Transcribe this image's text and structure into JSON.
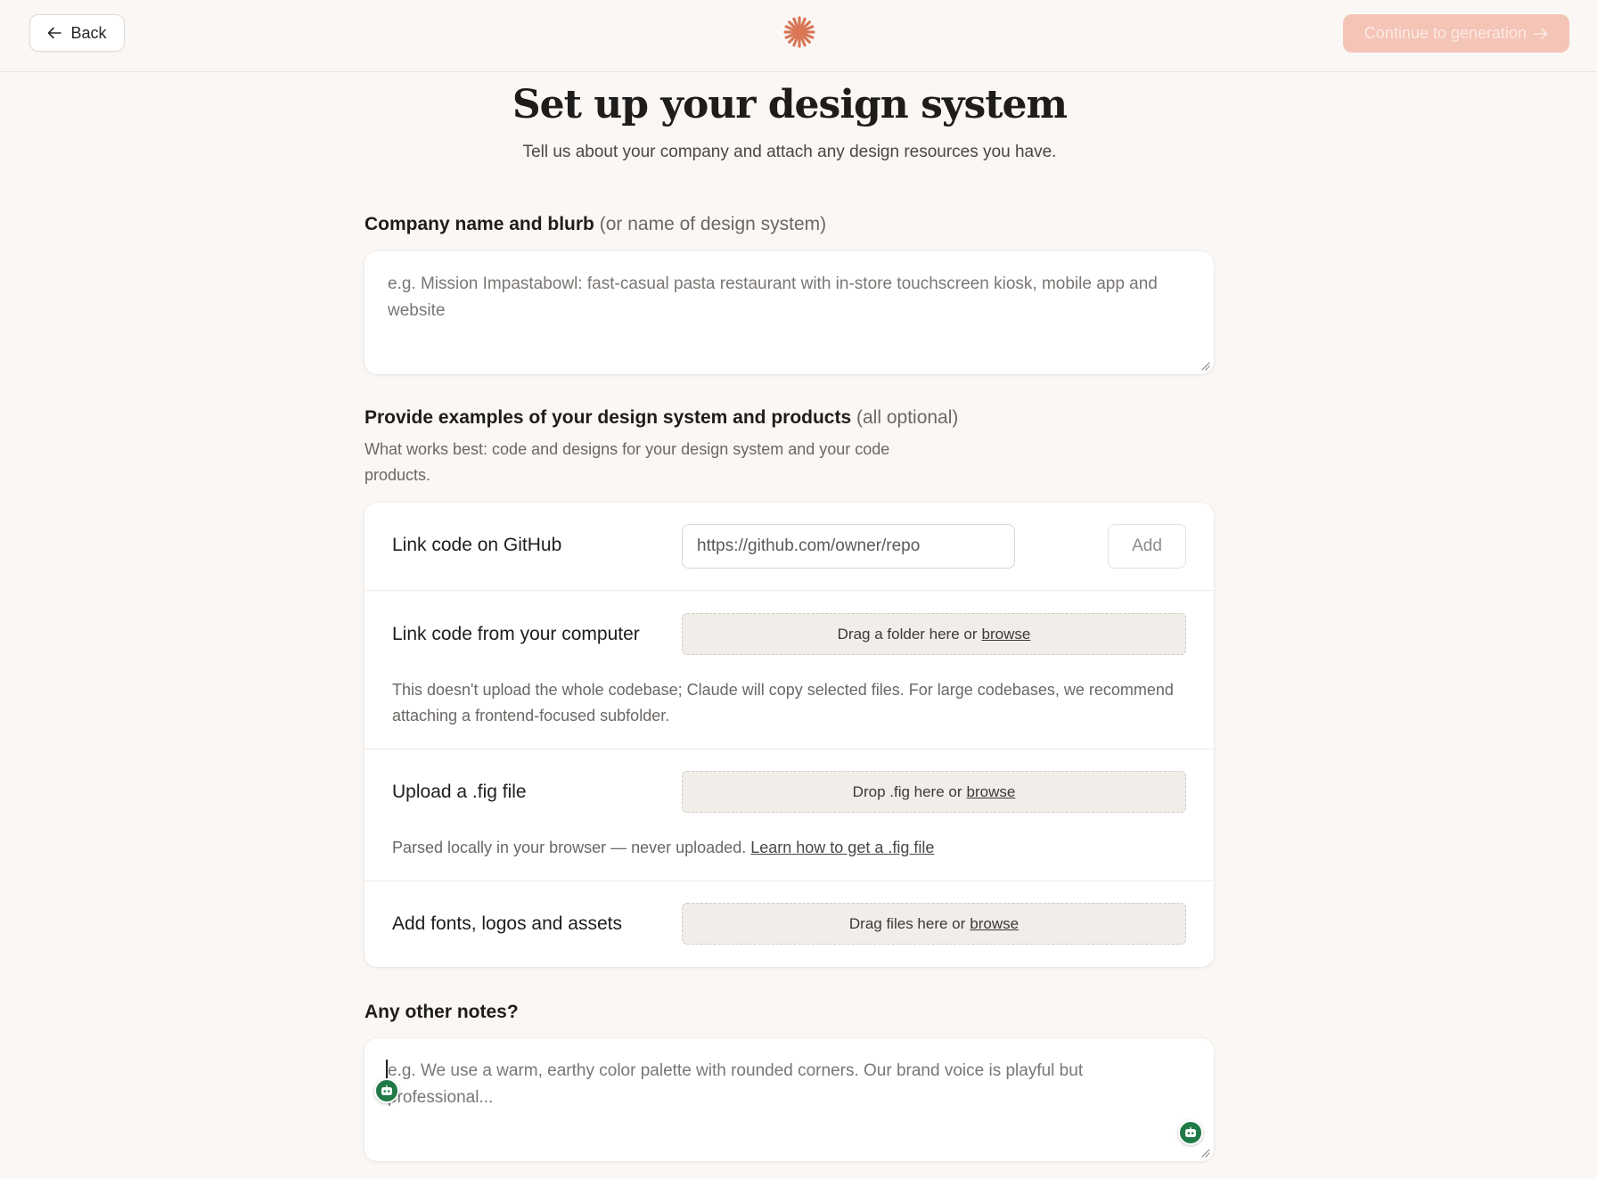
{
  "header": {
    "back_label": "Back",
    "continue_label": "Continue to generation",
    "colors": {
      "accent": "#d97757",
      "continue_bg": "#f4c4b6"
    }
  },
  "page": {
    "title": "Set up your design system",
    "subtitle": "Tell us about your company and attach any design resources you have."
  },
  "company": {
    "label_bold": "Company name and blurb",
    "label_muted": "(or name of design system)",
    "placeholder": "e.g. Mission Impastabowl: fast-casual pasta restaurant with in-store touchscreen kiosk, mobile app and website"
  },
  "examples": {
    "label_bold": "Provide examples of your design system and products",
    "label_muted": "(all optional)",
    "help": "What works best: code and designs for your design system and your code products."
  },
  "github": {
    "label": "Link code on GitHub",
    "placeholder": "https://github.com/owner/repo",
    "add_label": "Add"
  },
  "computer": {
    "label": "Link code from your computer",
    "drop_text": "Drag a folder here or",
    "browse_label": "browse",
    "note": "This doesn't upload the whole codebase; Claude will copy selected files. For large codebases, we recommend attaching a frontend-focused subfolder."
  },
  "fig": {
    "label": "Upload a .fig file",
    "drop_text": "Drop .fig here or",
    "browse_label": "browse",
    "note": "Parsed locally in your browser — never uploaded.",
    "note_link": "Learn how to get a .fig file"
  },
  "assets": {
    "label": "Add fonts, logos and assets",
    "drop_text": "Drag files here or",
    "browse_label": "browse"
  },
  "notes": {
    "label": "Any other notes?",
    "placeholder": "e.g. We use a warm, earthy color palette with rounded corners. Our brand voice is playful but professional..."
  }
}
